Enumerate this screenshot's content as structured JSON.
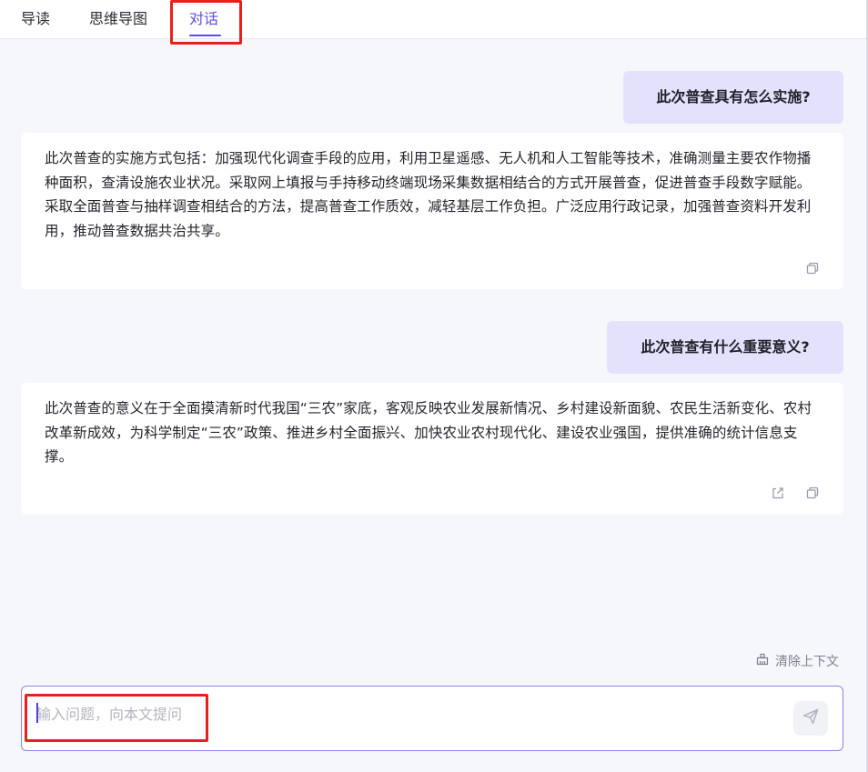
{
  "tabs": [
    {
      "label": "导读",
      "active": false
    },
    {
      "label": "思维导图",
      "active": false
    },
    {
      "label": "对话",
      "active": true
    }
  ],
  "colors": {
    "accent": "#5b4ee6",
    "question_bg": "#e3e1fb",
    "highlight_box": "#e8201a",
    "page_bg": "#f6f7fb"
  },
  "conversation": [
    {
      "question": "此次普查具有怎么实施?",
      "answer": "此次普查的实施方式包括：加强现代化调查手段的应用，利用卫星遥感、无人机和人工智能等技术，准确测量主要农作物播种面积，查清设施农业状况。采取网上填报与手持移动终端现场采集数据相结合的方式开展普查，促进普查手段数字赋能。采取全面普查与抽样调查相结合的方法，提高普查工作质效，减轻基层工作负担。广泛应用行政记录，加强普查资料开发利用，推动普查数据共治共享。",
      "actions": [
        "copy-icon"
      ]
    },
    {
      "question": "此次普查有什么重要意义?",
      "answer": "此次普查的意义在于全面摸清新时代我国“三农”家底，客观反映农业发展新情况、乡村建设新面貌、农民生活新变化、农村改革新成效，为科学制定“三农”政策、推进乡村全面振兴、加快农业农村现代化、建设农业强国，提供准确的统计信息支撑。",
      "actions": [
        "share-icon",
        "copy-icon"
      ]
    }
  ],
  "toolbar": {
    "clear_context_label": "清除上下文",
    "clear_icon": "broom-icon"
  },
  "input": {
    "placeholder": "输入问题，向本文提问",
    "value": "",
    "send_icon": "send-icon"
  }
}
